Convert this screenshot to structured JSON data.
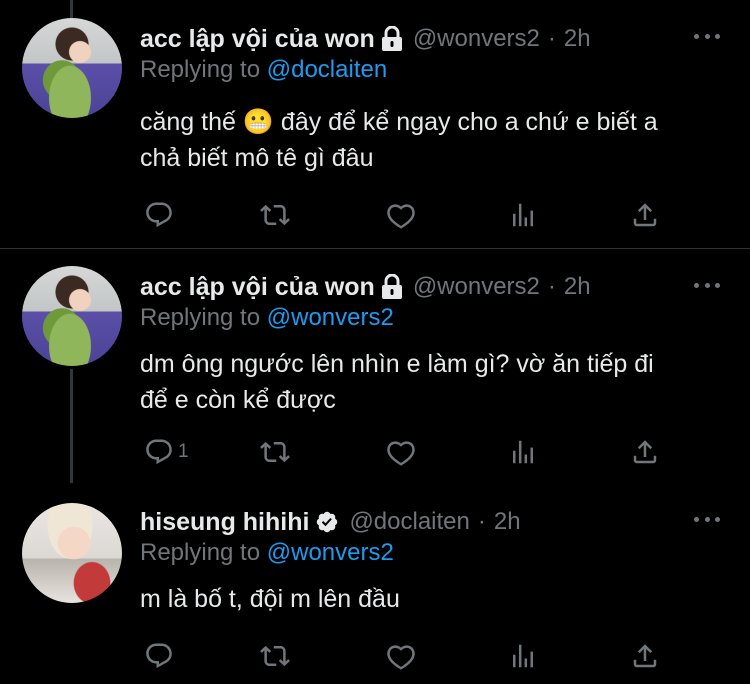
{
  "tweets": [
    {
      "name": "acc lập vội của won",
      "handle": "@wonvers2",
      "dot": "·",
      "time": "2h",
      "replying_prefix": "Replying to",
      "replying_to": "@doclaiten",
      "lines": [
        "căng thế 😬  đây để kể ngay cho a chứ e biết a",
        "chả biết mô tê gì đâu"
      ],
      "reply_count": "",
      "account_badge": "lock"
    },
    {
      "name": "acc lập vội của won",
      "handle": "@wonvers2",
      "dot": "·",
      "time": "2h",
      "replying_prefix": "Replying to",
      "replying_to": "@wonvers2",
      "lines": [
        "dm ông ngước lên nhìn e làm gì? vờ ăn tiếp đi",
        "để e còn kể được"
      ],
      "reply_count": "1",
      "account_badge": "lock"
    },
    {
      "name": "hiseung hihihi",
      "handle": "@doclaiten",
      "dot": "·",
      "time": "2h",
      "replying_prefix": "Replying to",
      "replying_to": "@wonvers2",
      "lines": [
        "m là bố t, đội m lên đầu"
      ],
      "reply_count": "",
      "account_badge": "verified"
    }
  ],
  "colors": {
    "background": "#000000",
    "text": "#e7e9ea",
    "muted": "#71767b",
    "mention": "#1d9bf0",
    "divider": "#2f3336"
  }
}
